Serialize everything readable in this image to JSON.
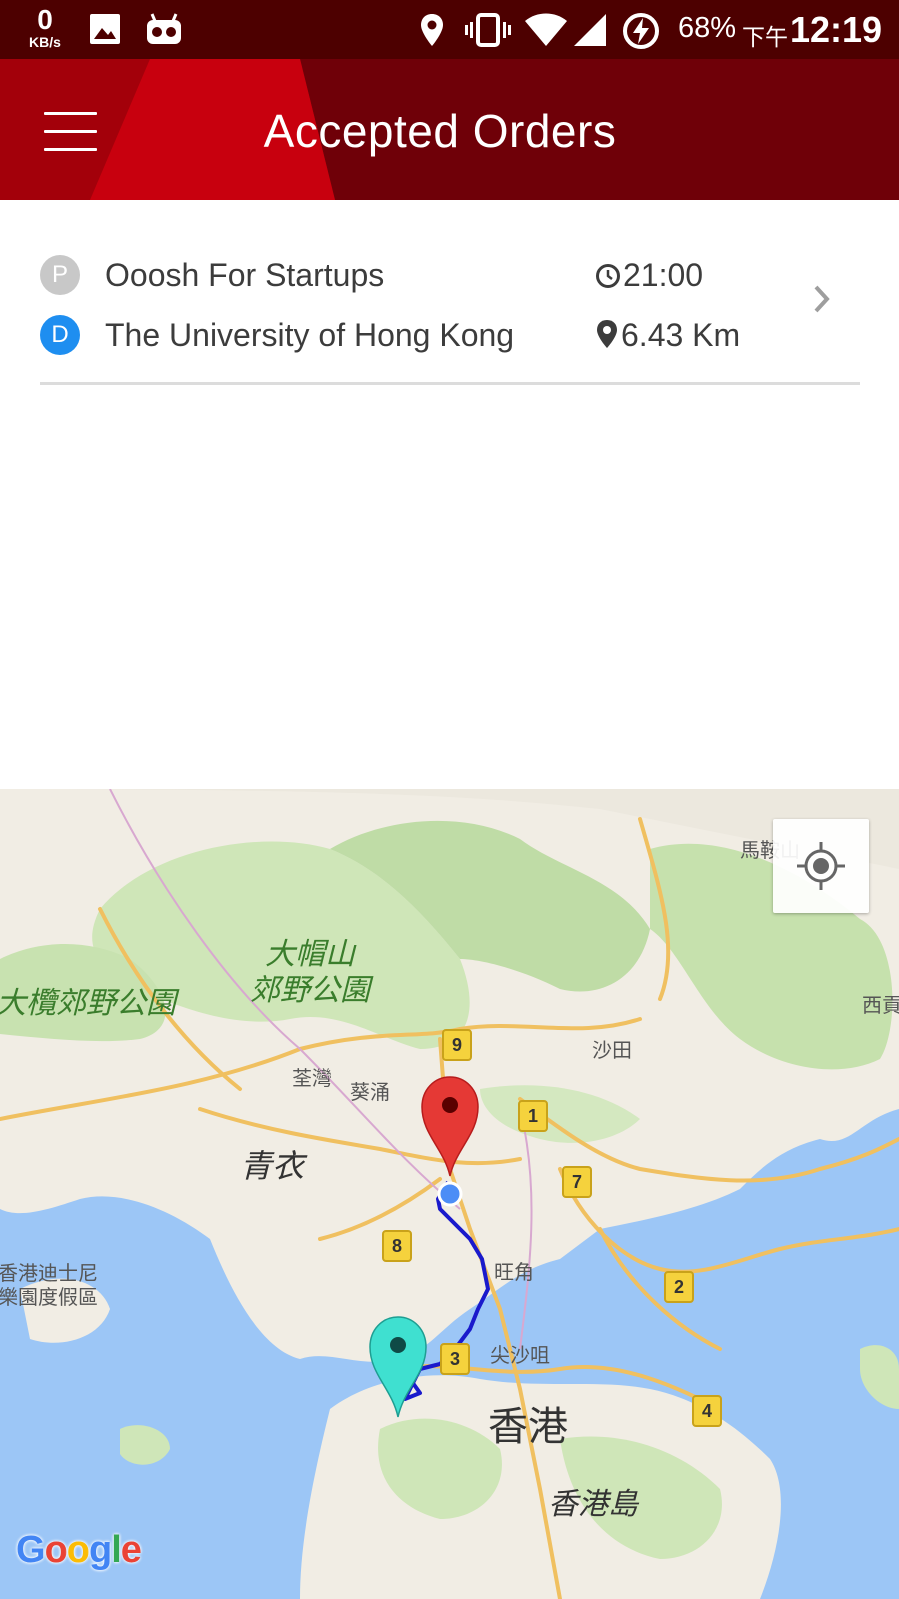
{
  "status_bar": {
    "net_speed": "0",
    "net_unit": "KB/s",
    "battery": "68%",
    "time_prefix": "下午",
    "time": "12:19"
  },
  "app_bar": {
    "title": "Accepted Orders",
    "menu_icon": "hamburger-menu-icon",
    "colors": {
      "primary": "#6f0008",
      "accent": "#b0000c"
    }
  },
  "order": {
    "pickup_badge": "P",
    "dropoff_badge": "D",
    "pickup": "Ooosh For Startups",
    "dropoff": "The University of Hong Kong",
    "time": "21:00",
    "distance": "6.43 Km",
    "badge_colors": {
      "pickup": "#c8c8c8",
      "dropoff": "#1e8ef0"
    }
  },
  "map": {
    "labels": {
      "park1_line1": "大帽山",
      "park1_line2": "郊野公園",
      "park2": "大欖郊野公園",
      "tsing_yi": "青衣",
      "tsuen_wan": "荃灣",
      "kwai_chung": "葵涌",
      "sha_tin": "沙田",
      "ma_on_shan": "馬鞍山",
      "sai_kung": "西貢",
      "mong_kok": "旺角",
      "tsim_sha_tsui": "尖沙咀",
      "hong_kong": "香港",
      "hk_island": "香港島",
      "disney_line1": "香港迪士尼",
      "disney_line2": "樂園度假區"
    },
    "routes": [
      "9",
      "1",
      "7",
      "8",
      "2",
      "3",
      "4"
    ],
    "markers": {
      "origin_color": "#e53935",
      "destination_color": "#3fe0d0",
      "route_color": "#1a1acc"
    },
    "logo": "Google"
  }
}
